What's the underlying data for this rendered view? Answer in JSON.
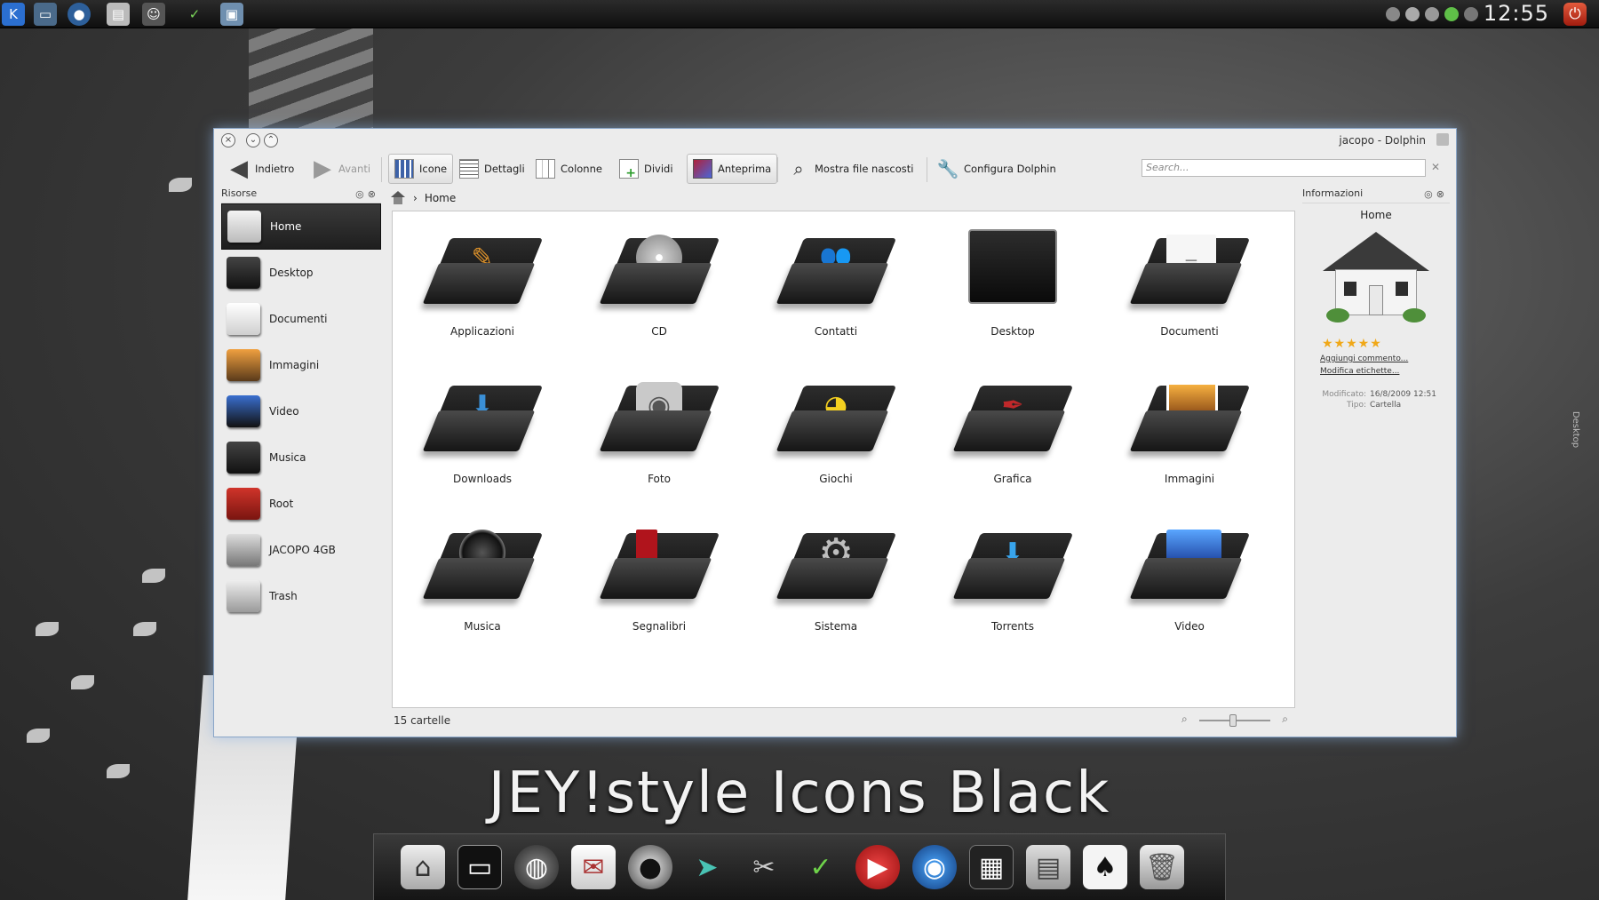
{
  "panel": {
    "launchers": [
      "kde-menu-icon",
      "computer-icon",
      "browser-icon",
      "files-icon",
      "user-icon",
      "check-icon",
      "window-icon"
    ],
    "clock": "12:55"
  },
  "window": {
    "title": "jacopo - Dolphin"
  },
  "toolbar": {
    "back": "Indietro",
    "forward": "Avanti",
    "icons": "Icone",
    "details": "Dettagli",
    "columns": "Colonne",
    "split": "Dividi",
    "preview": "Anteprima",
    "show_hidden": "Mostra file nascosti",
    "configure": "Configura Dolphin",
    "search_placeholder": "Search..."
  },
  "places": {
    "title": "Risorse",
    "items": [
      {
        "label": "Home",
        "icon": "home-icon"
      },
      {
        "label": "Desktop",
        "icon": "desktop-icon"
      },
      {
        "label": "Documenti",
        "icon": "documents-icon"
      },
      {
        "label": "Immagini",
        "icon": "images-icon"
      },
      {
        "label": "Video",
        "icon": "video-icon"
      },
      {
        "label": "Musica",
        "icon": "music-icon"
      },
      {
        "label": "Root",
        "icon": "root-icon"
      },
      {
        "label": "JACOPO 4GB",
        "icon": "usb-drive-icon"
      },
      {
        "label": "Trash",
        "icon": "trash-icon"
      }
    ]
  },
  "breadcrumb": {
    "current": "Home"
  },
  "view": {
    "items": [
      {
        "label": "Applicazioni",
        "icon": "applications-folder-icon"
      },
      {
        "label": "CD",
        "icon": "cd-folder-icon"
      },
      {
        "label": "Contatti",
        "icon": "contacts-folder-icon"
      },
      {
        "label": "Desktop",
        "icon": "desktop-folder-icon"
      },
      {
        "label": "Documenti",
        "icon": "documents-folder-icon"
      },
      {
        "label": "Downloads",
        "icon": "downloads-folder-icon"
      },
      {
        "label": "Foto",
        "icon": "photo-folder-icon"
      },
      {
        "label": "Giochi",
        "icon": "games-folder-icon"
      },
      {
        "label": "Grafica",
        "icon": "graphics-folder-icon"
      },
      {
        "label": "Immagini",
        "icon": "images-folder-icon"
      },
      {
        "label": "Musica",
        "icon": "music-folder-icon"
      },
      {
        "label": "Segnalibri",
        "icon": "bookmarks-folder-icon"
      },
      {
        "label": "Sistema",
        "icon": "system-folder-icon"
      },
      {
        "label": "Torrents",
        "icon": "torrents-folder-icon"
      },
      {
        "label": "Video",
        "icon": "video-folder-icon"
      }
    ],
    "status": "15 cartelle",
    "zoom": 0.5
  },
  "info": {
    "title": "Informazioni",
    "name": "Home",
    "rating": 5,
    "add_comment": "Aggiungi commento...",
    "edit_tags": "Modifica etichette...",
    "modified_label": "Modificato:",
    "modified_value": "16/8/2009 12:51",
    "type_label": "Tipo:",
    "type_value": "Cartella"
  },
  "side_label": "Desktop",
  "banner": "JEY!style Icons Black",
  "dock": {
    "items": [
      "home-icon",
      "terminal-icon",
      "globe-icon",
      "mail-icon",
      "gimp-icon",
      "bird-icon",
      "tools-icon",
      "check-icon",
      "media-player-icon",
      "browser-icon",
      "video-icon",
      "files-icon",
      "cards-icon",
      "trash-icon"
    ]
  },
  "colors": {
    "window_border": "#8aa6c8",
    "selection": "#1e1e1e",
    "stars": "#f0a818",
    "power": "#c43a22"
  }
}
